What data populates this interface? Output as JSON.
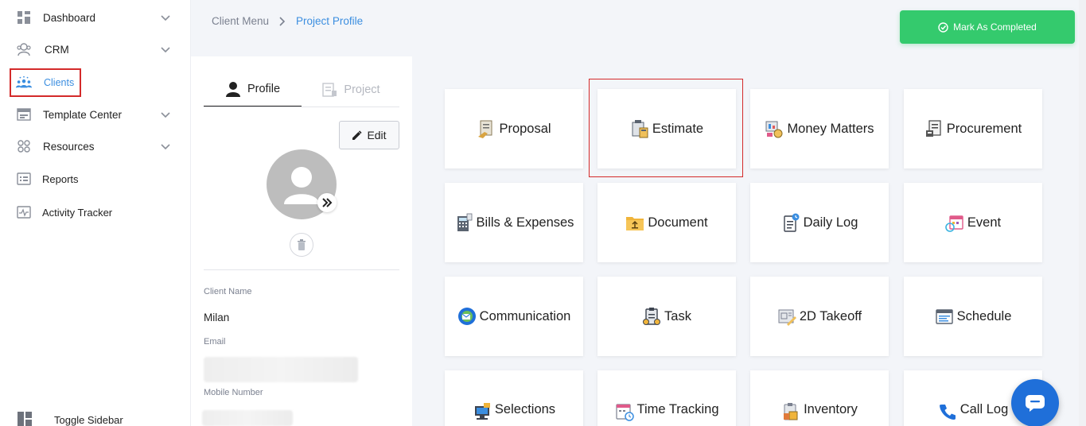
{
  "sidebar": {
    "items": [
      {
        "label": "Dashboard",
        "icon": "dashboard-icon",
        "has_chevron": true
      },
      {
        "label": "CRM",
        "icon": "crm-icon",
        "has_chevron": true
      },
      {
        "label": "Clients",
        "icon": "clients-icon",
        "has_chevron": false,
        "active": true
      },
      {
        "label": "Template Center",
        "icon": "template-icon",
        "has_chevron": true
      },
      {
        "label": "Resources",
        "icon": "resources-icon",
        "has_chevron": true
      },
      {
        "label": "Reports",
        "icon": "reports-icon",
        "has_chevron": false
      },
      {
        "label": "Activity Tracker",
        "icon": "activity-icon",
        "has_chevron": false
      }
    ],
    "toggle_label": "Toggle Sidebar"
  },
  "breadcrumb": {
    "parent": "Client Menu",
    "current": "Project Profile"
  },
  "actions": {
    "complete_label": "Mark As Completed"
  },
  "profile": {
    "tabs": {
      "profile": "Profile",
      "project": "Project"
    },
    "edit_label": "Edit",
    "client_name_label": "Client Name",
    "client_name": "Milan",
    "email_label": "Email",
    "mobile_label": "Mobile Number"
  },
  "modules": [
    {
      "label": "Proposal",
      "icon": "proposal-icon"
    },
    {
      "label": "Estimate",
      "icon": "estimate-icon"
    },
    {
      "label": "Money Matters",
      "icon": "money-icon"
    },
    {
      "label": "Procurement",
      "icon": "procurement-icon"
    },
    {
      "label": "Bills & Expenses",
      "icon": "bills-icon"
    },
    {
      "label": "Document",
      "icon": "document-icon"
    },
    {
      "label": "Daily Log",
      "icon": "daily-log-icon"
    },
    {
      "label": "Event",
      "icon": "event-icon"
    },
    {
      "label": "Communication",
      "icon": "communication-icon"
    },
    {
      "label": "Task",
      "icon": "task-icon"
    },
    {
      "label": "2D Takeoff",
      "icon": "takeoff-icon"
    },
    {
      "label": "Schedule",
      "icon": "schedule-icon"
    },
    {
      "label": "Selections",
      "icon": "selections-icon"
    },
    {
      "label": "Time Tracking",
      "icon": "time-tracking-icon"
    },
    {
      "label": "Inventory",
      "icon": "inventory-icon"
    },
    {
      "label": "Call Log",
      "icon": "call-log-icon"
    }
  ],
  "colors": {
    "accent": "#3b8ee0",
    "success": "#34ca6d",
    "highlight": "#d42a2a",
    "chat": "#1f6fd9"
  }
}
